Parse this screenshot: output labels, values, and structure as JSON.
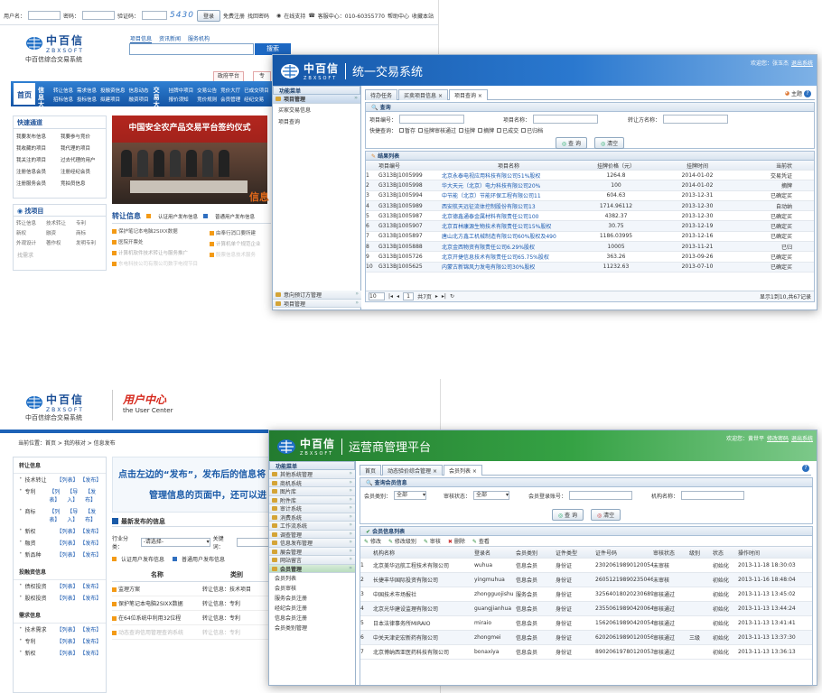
{
  "site": {
    "brand_cn": "中百信",
    "brand_en": "ZBXSOFT",
    "brand_sub": "中百信综合交易系统",
    "topbar": {
      "user_label": "用户名：",
      "pwd_label": "密码：",
      "captcha_label": "验证码：",
      "captcha_value": "5430",
      "login": "登录",
      "register": "免费注册",
      "forgot": "找回密码",
      "support": "在线支持",
      "hotline": "客服中心：010-60355770",
      "help": "帮助中心",
      "fav": "收藏本站"
    },
    "search_tabs": [
      "项目信息",
      "资讯新闻",
      "服务机构"
    ],
    "search_btn": "搜索",
    "nav_tabs": [
      "政府平台",
      "专"
    ],
    "nav": {
      "home": "首页",
      "info_hall": "信息大厅",
      "links": [
        "转让信息",
        "需求信息",
        "投融资信息",
        "信息动态",
        "招标信息",
        "投标信息",
        "拟建项目",
        "融资项目"
      ],
      "trade_hall": "交易大厅",
      "trade_links": [
        "挂牌中项目",
        "交易公告",
        "竞价大厅",
        "已成交项目",
        "报价须知",
        "竞价规则",
        "会员管理",
        "经纪交易"
      ]
    },
    "quick": {
      "title": "快速通道",
      "items": [
        "我要发布信息",
        "我要参与竞价",
        "我收藏的项目",
        "我代理的项目",
        "我关注的项目",
        "过去代理的用户",
        "注册信息会员",
        "注册经纪会员",
        "注册服务会员",
        "竞拍员信息"
      ]
    },
    "find": {
      "title": "找项目",
      "rows": [
        "转让信息",
        "技术转让",
        "专利",
        "新权",
        "融资",
        "商标",
        "外观设计",
        "著作权",
        "发明专利"
      ],
      "need": "找需求"
    },
    "banner_title": "中国安全农产品交易平台签约仪式",
    "banner_side": "信息",
    "transfer": {
      "title": "转让信息",
      "tag1": "认证用户发布信息",
      "tag2": "普通用户发布信息",
      "items": [
        "保护笔记本电脑2SIXX数据",
        "医院开票处",
        "计算机软件技术转让与服务推广",
        "东电科技公司有限公司数字电视节目"
      ],
      "right_items": [
        "由奉行消口要所建",
        "计算机单个规范企业",
        "股票信息技术服务"
      ]
    }
  },
  "trading": {
    "title_cn": "中百信",
    "title_en": "ZBXSOFT",
    "title_sys": "统一交易系统",
    "welcome": "欢迎您：张玉杰",
    "logout": "退出系统",
    "theme": "主题",
    "menu_title": "功能菜单",
    "menu_section": "项目管理",
    "menu_items": [
      "买家交易信息",
      "项目查询"
    ],
    "menu_bottom": [
      "意向预订方管理",
      "项目管理"
    ],
    "tabs": [
      "待办任务",
      "买卖项目信息",
      "项目查询"
    ],
    "query_title": "查询",
    "fields": {
      "code": "项目编号：",
      "name": "项目名称：",
      "transferor": "转让方名称：",
      "quick": "快捷查询："
    },
    "filters": [
      "暂存",
      "挂牌审核通过",
      "挂牌",
      "摘牌",
      "已成交",
      "已归档"
    ],
    "query_btn": "查 询",
    "clear_btn": "清空",
    "result_title": "结果列表",
    "columns": [
      "",
      "项目编号",
      "项目名称",
      "挂牌价格（元）",
      "挂牌时间",
      "当前状"
    ],
    "rows": [
      [
        "1",
        "G313BJ1005999",
        "北京永泰电视应用科技有限公司51%股权",
        "1264.8",
        "2014-01-02",
        "交易凭证"
      ],
      [
        "2",
        "G313BJ1005998",
        "华大天元（北京）电力科技有限公司20%",
        "100",
        "2014-01-02",
        "摘牌"
      ],
      [
        "3",
        "G313BJ1005994",
        "中节能（北京）节能环保工程有限公司11",
        "604.63",
        "2013-12-31",
        "已确定买"
      ],
      [
        "4",
        "G313BJ1005989",
        "西安航天远征流体控制股份有限公司13",
        "1714.96112",
        "2013-12-30",
        "自动纳"
      ],
      [
        "5",
        "G313BJ1005987",
        "北京德鑫通泰金属材料有限责任公司100",
        "4382.37",
        "2013-12-30",
        "已确定买"
      ],
      [
        "6",
        "G313BJ1005907",
        "北京百林康源生物技术有限责任公司15%股权",
        "30.75",
        "2013-12-19",
        "已确定买"
      ],
      [
        "7",
        "G313BJ1005897",
        "唐山北方鑫工机械制造有限公司60%股权及490",
        "1186.03995",
        "2013-12-16",
        "已确定买"
      ],
      [
        "8",
        "G313BJ1005888",
        "北京金西物资有限责任公司6.29%股权",
        "10005",
        "2013-11-21",
        "已归"
      ],
      [
        "9",
        "G313BJ1005726",
        "北京开捷信息技术有限责任公司65.75%股权",
        "363.26",
        "2013-09-26",
        "已确定买"
      ],
      [
        "10",
        "G313BJ1005625",
        "内蒙古新锦风力发电有限公司30%股权",
        "11232.63",
        "2013-07-10",
        "已确定买"
      ]
    ],
    "pager": {
      "size": "10",
      "page": "1",
      "total_pages": "共7页",
      "summary": "显示1到10,共67记录"
    }
  },
  "user_center": {
    "brand_cn": "中百信",
    "brand_en": "ZBXSOFT",
    "brand_sub": "中百信综合交易系统",
    "title_cn": "用户中心",
    "title_en": "the User Center",
    "breadcrumb": "当前位置：首页 > 我的核对 > 信息发布",
    "hint": "点击左边的“发布”，发布后的信息将",
    "hint2": "管理信息的页面中，还可以进",
    "sidebar": [
      {
        "title": "转让信息",
        "items": [
          "技术转让",
          "专利",
          "商标",
          "新权",
          "融资",
          "新品种"
        ]
      },
      {
        "title": "投融资信息",
        "items": [
          "债权投资",
          "股权投资"
        ]
      },
      {
        "title": "需求信息",
        "items": [
          "技术需求",
          "专利",
          "新权"
        ]
      }
    ],
    "link_list": "【列表】",
    "link_publish": "【发布】",
    "link_import": "【导入】",
    "latest": "最新发布的信息",
    "cat_label": "行业分类：",
    "cat_value": "-请选择-",
    "keyword_label": "关键词：",
    "tag1": "认证用户发布信息",
    "tag2": "普通用户发布信息",
    "table_cols": [
      "名称",
      "类别"
    ],
    "table_rows": [
      [
        "监理方案",
        "转让信息：技术项目"
      ],
      [
        "保护笔记本电脑2SIXX数据",
        "转让信息：专利"
      ],
      [
        "在64位系统中利用32位程",
        "转让信息：专利"
      ],
      [
        "动态查询信用管理查询系统",
        "转让信息：专利"
      ]
    ]
  },
  "operator": {
    "title_cn": "中百信",
    "title_en": "ZBXSOFT",
    "title_sys": "运营商管理平台",
    "welcome": "欢迎您：黄世平",
    "change_pwd": "修改密码",
    "logout": "退出系统",
    "menu_title": "功能菜单",
    "menu": [
      "其他系统管理",
      "商机系统",
      "图片库",
      "附件库",
      "审计系统",
      "消费系统",
      "工作流系统",
      "调查管理",
      "信息发布管理",
      "展会管理",
      "网站留言",
      "会员管理"
    ],
    "sub": [
      "会员列表",
      "会员审核",
      "服务会员注册",
      "经纪会员注册",
      "信息会员注册",
      "会员类别管理"
    ],
    "tabs": [
      "首页",
      "动态验价综合管理",
      "会员列表"
    ],
    "query_title": "查询会员信息",
    "fields": {
      "type": "会员类别：",
      "type_v": "全部",
      "audit": "审核状态：",
      "audit_v": "全部",
      "login": "会员登录账号：",
      "org": "机构名称："
    },
    "query_btn": "查 询",
    "clear_btn": "清空",
    "list_title": "会员信息列表",
    "toolbar": [
      "修改",
      "修改级别",
      "审核",
      "删除",
      "查看"
    ],
    "columns": [
      "",
      "机构名称",
      "登录名",
      "会员类别",
      "证件类型",
      "证件号码",
      "审核状态",
      "级别",
      "状态",
      "操作时间"
    ],
    "rows": [
      [
        "1",
        "北京美华远航工程技术有限公司",
        "wuhua",
        "信息会员",
        "身份证",
        "230206198901200543",
        "未审核",
        "",
        "初始化",
        "2013-11-18 18:30:03"
      ],
      [
        "2",
        "长捷丰华国际投资有限公司",
        "yingmuhua",
        "信息会员",
        "身份证",
        "260512198902350463",
        "未审核",
        "",
        "初始化",
        "2013-11-16 18:48:04"
      ],
      [
        "3",
        "中国技术市场报社",
        "zhongguojishu",
        "服务会员",
        "身份证",
        "325640180202306892",
        "审核通过",
        "",
        "初始化",
        "2013-11-13 13:45:02"
      ],
      [
        "4",
        "北京光华建设监理有限公司",
        "guangjianhua",
        "信息会员",
        "身份证",
        "235506198904200642",
        "审核通过",
        "",
        "初始化",
        "2013-11-13 13:44:24"
      ],
      [
        "5",
        "日本法律事务所MIRAIO",
        "miraio",
        "信息会员",
        "身份证",
        "156206198904200543",
        "审核通过",
        "",
        "初始化",
        "2013-11-13 13:41:41"
      ],
      [
        "6",
        "中关天津史宏新药有限公司",
        "zhongmei",
        "信息会员",
        "身份证",
        "620206198901200569",
        "审核通过",
        "三级",
        "初始化",
        "2013-11-13 13:37:30"
      ],
      [
        "7",
        "北京博纳西亚医药科技有限公司",
        "bonaxiya",
        "信息会员",
        "身份证",
        "890206197801200533",
        "审核通过",
        "",
        "初始化",
        "2013-11-13 13:36:13"
      ]
    ]
  },
  "colors": {
    "blue": "#1a5aa8",
    "green": "#2a8a3a",
    "orange": "#f39a16",
    "red": "#d62a1e"
  }
}
